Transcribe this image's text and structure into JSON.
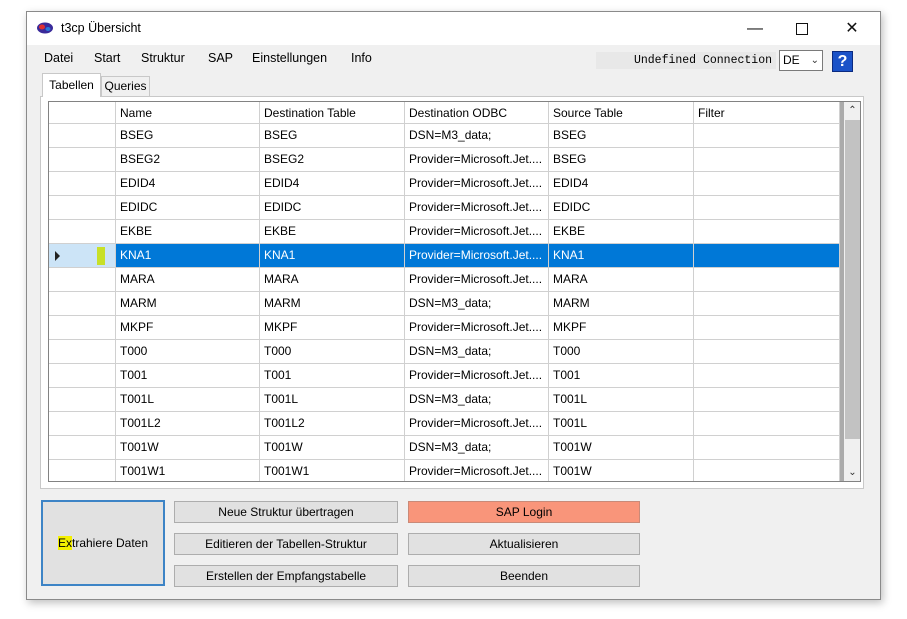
{
  "window": {
    "title": "t3cp Übersicht"
  },
  "menu": [
    "Datei",
    "Start",
    "Struktur",
    "SAP",
    "Einstellungen",
    "Info"
  ],
  "connection": {
    "status": "Undefined Connection",
    "language": "DE",
    "help_label": "?"
  },
  "tabs": [
    "Tabellen",
    "Queries"
  ],
  "table": {
    "columns": [
      "Name",
      "Destination Table",
      "Destination ODBC",
      "Source Table",
      "Filter"
    ],
    "rows": [
      [
        "BSEG",
        "BSEG",
        "DSN=M3_data;",
        "BSEG",
        ""
      ],
      [
        "BSEG2",
        "BSEG2",
        "Provider=Microsoft.Jet....",
        "BSEG",
        ""
      ],
      [
        "EDID4",
        "EDID4",
        "Provider=Microsoft.Jet....",
        "EDID4",
        ""
      ],
      [
        "EDIDC",
        "EDIDC",
        "Provider=Microsoft.Jet....",
        "EDIDC",
        ""
      ],
      [
        "EKBE",
        "EKBE",
        "Provider=Microsoft.Jet....",
        "EKBE",
        ""
      ],
      [
        "KNA1",
        "KNA1",
        "Provider=Microsoft.Jet....",
        "KNA1",
        ""
      ],
      [
        "MARA",
        "MARA",
        "Provider=Microsoft.Jet....",
        "MARA",
        ""
      ],
      [
        "MARM",
        "MARM",
        "DSN=M3_data;",
        "MARM",
        ""
      ],
      [
        "MKPF",
        "MKPF",
        "Provider=Microsoft.Jet....",
        "MKPF",
        ""
      ],
      [
        "T000",
        "T000",
        "DSN=M3_data;",
        "T000",
        ""
      ],
      [
        "T001",
        "T001",
        "Provider=Microsoft.Jet....",
        "T001",
        ""
      ],
      [
        "T001L",
        "T001L",
        "DSN=M3_data;",
        "T001L",
        ""
      ],
      [
        "T001L2",
        "T001L2",
        "Provider=Microsoft.Jet....",
        "T001L",
        ""
      ],
      [
        "T001W",
        "T001W",
        "DSN=M3_data;",
        "T001W",
        ""
      ],
      [
        "T001W1",
        "T001W1",
        "Provider=Microsoft.Jet....",
        "T001W",
        ""
      ]
    ],
    "selected_row": 5
  },
  "buttons": {
    "extract_prefix": "Ex",
    "extract_rest": "trahiere Daten",
    "neue_struktur": "Neue Struktur übertragen",
    "editieren": "Editieren der Tabellen-Struktur",
    "erstellen": "Erstellen der Empfangstabelle",
    "sap_login": "SAP Login",
    "aktualisieren": "Aktualisieren",
    "beenden": "Beenden"
  },
  "colors": {
    "selection": "#0078d7",
    "sap_login": "#f9957a",
    "help": "#1a52c8",
    "highlight": "#f4f000"
  }
}
